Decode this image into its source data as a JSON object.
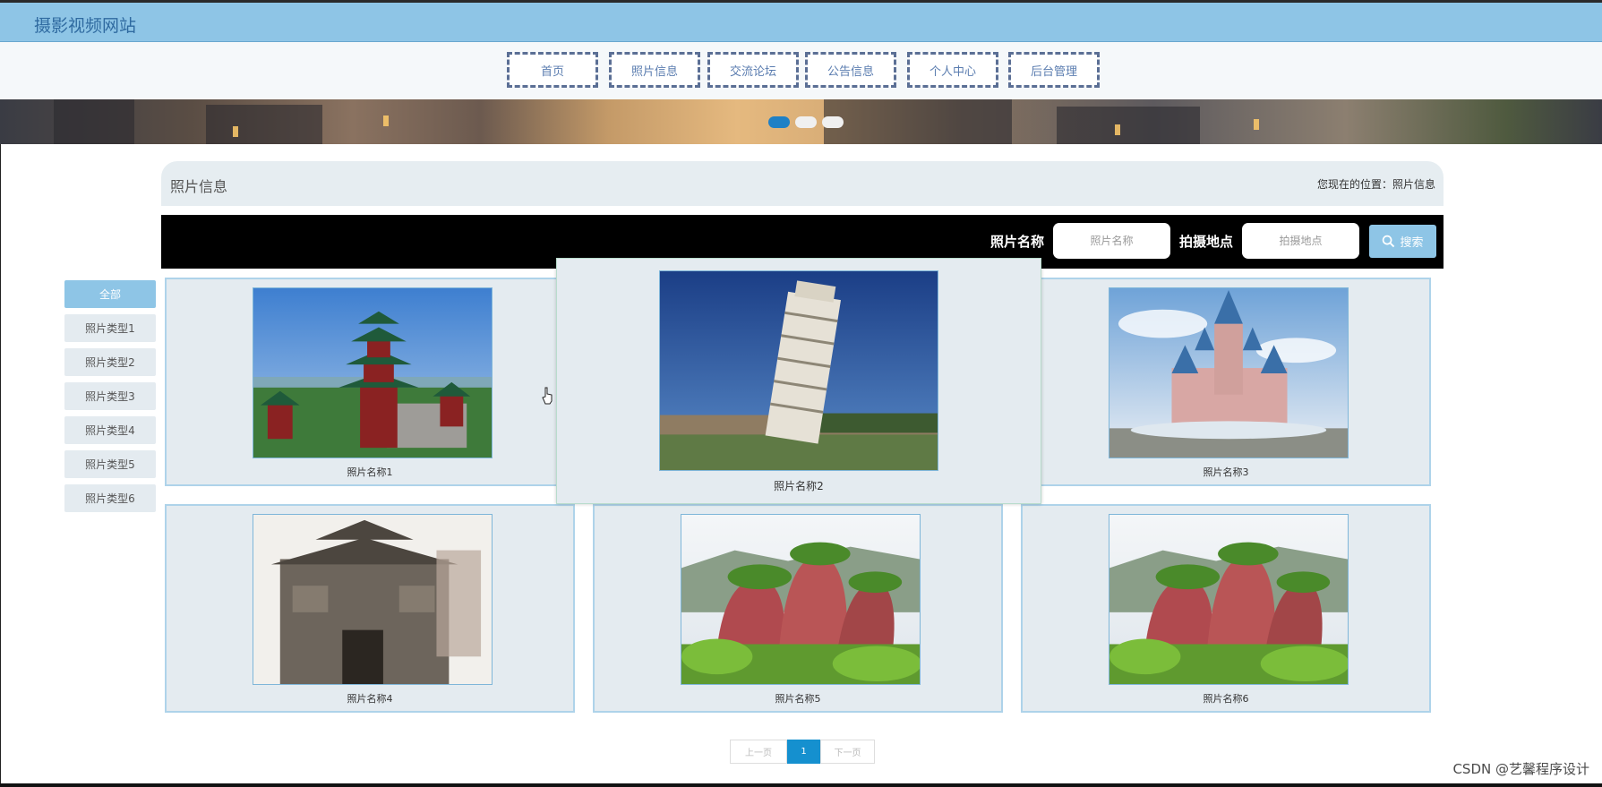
{
  "site": {
    "title": "摄影视频网站"
  },
  "nav": [
    {
      "label": "首页"
    },
    {
      "label": "照片信息"
    },
    {
      "label": "交流论坛"
    },
    {
      "label": "公告信息"
    },
    {
      "label": "个人中心"
    },
    {
      "label": "后台管理"
    }
  ],
  "banner": {
    "slides_total": 3,
    "active_slide": 1
  },
  "breadcrumb": {
    "title": "照片信息",
    "location": "您现在的位置：照片信息"
  },
  "search": {
    "name_label": "照片名称",
    "name_placeholder": "照片名称",
    "place_label": "拍摄地点",
    "place_placeholder": "拍摄地点",
    "button_label": "搜索"
  },
  "categories": [
    {
      "label": "全部",
      "active": true
    },
    {
      "label": "照片类型1"
    },
    {
      "label": "照片类型2"
    },
    {
      "label": "照片类型3"
    },
    {
      "label": "照片类型4"
    },
    {
      "label": "照片类型5"
    },
    {
      "label": "照片类型6"
    }
  ],
  "photos": [
    {
      "name": "照片名称1",
      "subject": "pagoda"
    },
    {
      "name": "照片名称2",
      "subject": "leaning-tower"
    },
    {
      "name": "照片名称3",
      "subject": "castle"
    },
    {
      "name": "照片名称4",
      "subject": "ancient-gate"
    },
    {
      "name": "照片名称5",
      "subject": "red-cliffs"
    },
    {
      "name": "照片名称6",
      "subject": "red-cliffs"
    }
  ],
  "pagination": {
    "prev_label": "上一页",
    "current_page": "1",
    "next_label": "下一页"
  },
  "watermark": "CSDN @艺馨程序设计",
  "colors": {
    "topbar": "#8ec5e6",
    "nav_border": "#5b6f95",
    "active_page": "#1590cf"
  }
}
